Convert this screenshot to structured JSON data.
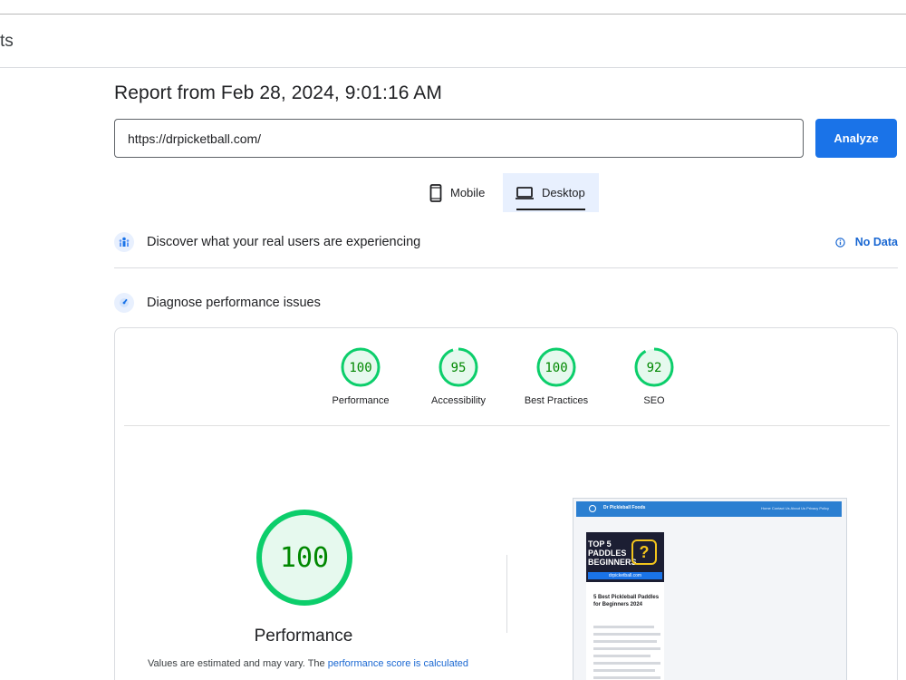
{
  "header": {
    "title": "ts"
  },
  "report": {
    "title": "Report from Feb 28, 2024, 9:01:16 AM"
  },
  "search": {
    "url": "https://drpicketball.com/",
    "analyze_label": "Analyze"
  },
  "device_tabs": [
    {
      "label": "Mobile",
      "icon": "smartphone-icon",
      "selected": false
    },
    {
      "label": "Desktop",
      "icon": "laptop-icon",
      "selected": true
    }
  ],
  "real_users": {
    "label": "Discover what your real users are experiencing",
    "status": "No Data",
    "icon": "people-icon"
  },
  "diagnose": {
    "label": "Diagnose performance issues",
    "icon": "speedometer-icon"
  },
  "scores": [
    {
      "name": "Performance",
      "value": 100
    },
    {
      "name": "Accessibility",
      "value": 95
    },
    {
      "name": "Best Practices",
      "value": 100
    },
    {
      "name": "SEO",
      "value": 92
    }
  ],
  "performance_detail": {
    "score": 100,
    "label": "Performance",
    "note_prefix": "Values are estimated and may vary. The ",
    "note_link": "performance score is calculated"
  },
  "screenshot_preview": {
    "site_name": "Dr Pickleball Foods",
    "nav_links": "Home   Contact Us   About Us   Privacy Policy",
    "hero_text": "TOP 5 PADDLES BEGINNERS",
    "hero_caption": "drpicketball.com",
    "post_title": "5 Best Pickleball Paddles for Beginners 2024"
  },
  "colors": {
    "accent": "#1a73e8",
    "pass": "#0cce6b",
    "pass_text": "#008800",
    "pass_bg": "#e6f9ee"
  }
}
